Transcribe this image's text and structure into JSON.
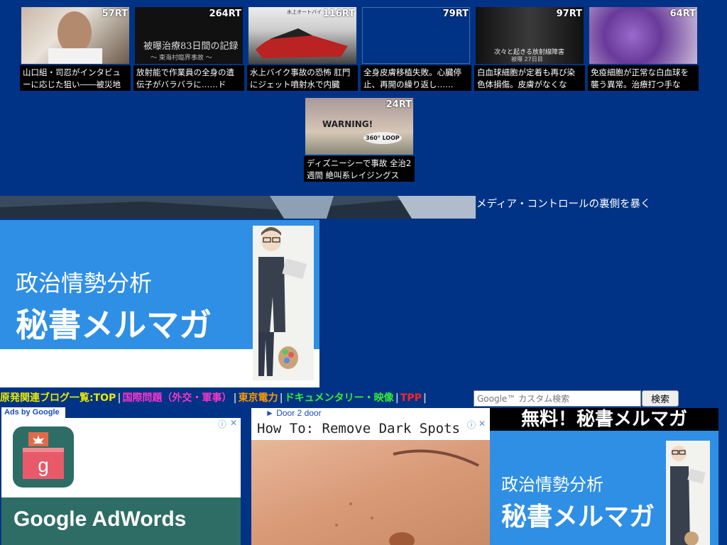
{
  "cards": [
    {
      "rt": "57RT",
      "caption": "山口組・司忍がインタビューに応じた狙い――被災地"
    },
    {
      "rt": "264RT",
      "caption": "放射能で作業員の全身の遺伝子がバラバラに……ド",
      "thumb_text": "被曝治療83日間の記録",
      "thumb_sub": "〜 東海村臨界事故 〜"
    },
    {
      "rt": "116RT",
      "caption": "水上バイク事故の恐怖 肛門にジェット噴射水で内臓",
      "thumb_text": "水上オートバイ"
    },
    {
      "rt": "79RT",
      "caption": "全身皮膚移植失敗。心臓停止、再開の繰り返し……"
    },
    {
      "rt": "97RT",
      "caption": "白血球細胞が定着も再び染色体損傷。皮膚がなくな",
      "thumb_text": "次々と起きる放射線障害",
      "thumb_sub": "被曝 27日目"
    },
    {
      "rt": "64RT",
      "caption": "免疫細胞が正常な白血球を襲う異常。治療打つ手な"
    },
    {
      "rt": "24RT",
      "caption": "ディズニーシーで事故 全治2週間 絶叫系レイジングス",
      "thumb_text": "WARNING!",
      "thumb_sub": "360° LOOP"
    }
  ],
  "media_text": "メディア・コントロールの裏側を暴く",
  "big_ad": {
    "line1": "政治情勢分析",
    "line2": "秘書メルマガ"
  },
  "nav": [
    {
      "label": "原発関連ブログ一覧:TOP",
      "color": "#e8e800"
    },
    {
      "label": "国際問題（外交・軍事）",
      "color": "#ff33cc"
    },
    {
      "label": "東京電力",
      "color": "#ff9900"
    },
    {
      "label": "ドキュメンタリー・映像",
      "color": "#33ee33"
    },
    {
      "label": "TPP",
      "color": "#ff2222"
    }
  ],
  "search": {
    "placeholder": "Google™ カスタム検索",
    "button": "検索"
  },
  "ads_by": "Ads by Google",
  "adwords": {
    "title": "Google AdWords"
  },
  "door_link": "► Door 2 door",
  "dark_spots_ad": {
    "title": "How To: Remove Dark Spots"
  },
  "right_ad": {
    "header": "無料！秘書メルマガ",
    "line1": "政治情勢分析",
    "line2": "秘書メルマガ"
  }
}
